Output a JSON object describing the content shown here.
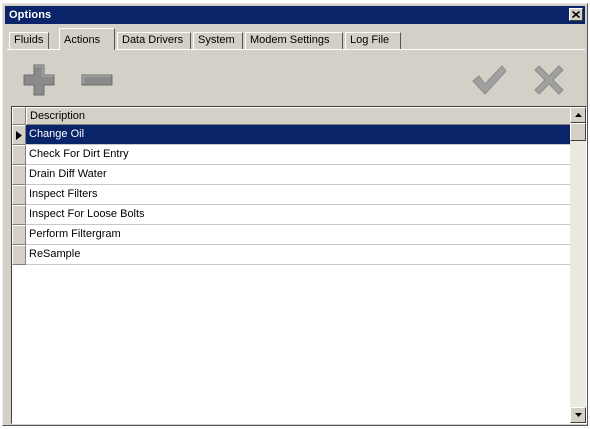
{
  "window": {
    "title": "Options"
  },
  "tabs": [
    {
      "label": "Fluids",
      "active": false
    },
    {
      "label": "Actions",
      "active": true
    },
    {
      "label": "Data Drivers",
      "active": false
    },
    {
      "label": "System",
      "active": false
    },
    {
      "label": "Modem Settings",
      "active": false
    },
    {
      "label": "Log File",
      "active": false
    }
  ],
  "toolbar": {
    "add_icon": "plus-icon",
    "remove_icon": "minus-icon",
    "accept_icon": "checkmark-icon",
    "cancel_icon": "x-icon"
  },
  "grid": {
    "column_header": "Description",
    "rows": [
      "Change Oil",
      "Check For Dirt Entry",
      "Drain Diff Water",
      "Inspect Filters",
      "Inspect For Loose Bolts",
      "Perform Filtergram",
      "ReSample"
    ],
    "selected_index": 0
  },
  "colors": {
    "titlebar": "#0a246a",
    "selection": "#0a246a",
    "face": "#d4d0c8",
    "icon_gray": "#8a8a8a"
  }
}
